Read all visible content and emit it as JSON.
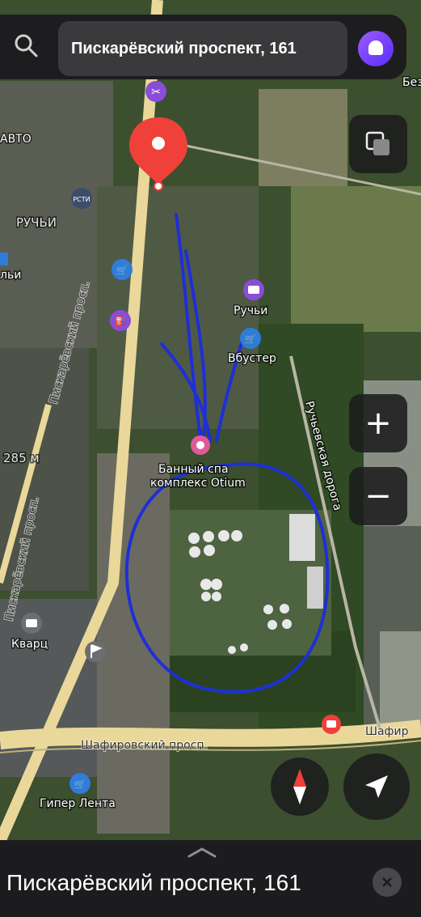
{
  "search": {
    "value": "Пискарёвский проспект, 161"
  },
  "labels": {
    "avto": "АВТО",
    "ruchyi_district": "РУЧЬИ",
    "bolshevikov": "льи",
    "ruchyi_poi": "Ручьи",
    "booster": "Вбустер",
    "bath_line1": "Банный спа",
    "bath_line2": "комплекс Otium",
    "kvarts": "Кварц",
    "giper_lenta": "Гипер Лента",
    "piskarevsky_road_1": "Пискарёвский просп.",
    "piskarevsky_road_2": "Пискарёвский просп.",
    "ruchyevskaya_road": "Ручьевская дорога",
    "shafirovsky_road": "Шафировский просп.",
    "shafir_right": "Шафир",
    "scale": "285 м",
    "top_right_fragment": "Безы",
    "rsti": "РСТИ"
  },
  "buttons": {
    "zoom_in": "+",
    "zoom_out": "−"
  },
  "bottom_sheet": {
    "title": "Пискарёвский проспект, 161"
  },
  "colors": {
    "pin": "#f0403a",
    "annotation": "#1f2fd6",
    "road": "#e9d89a",
    "panel": "#1c1c1e"
  }
}
